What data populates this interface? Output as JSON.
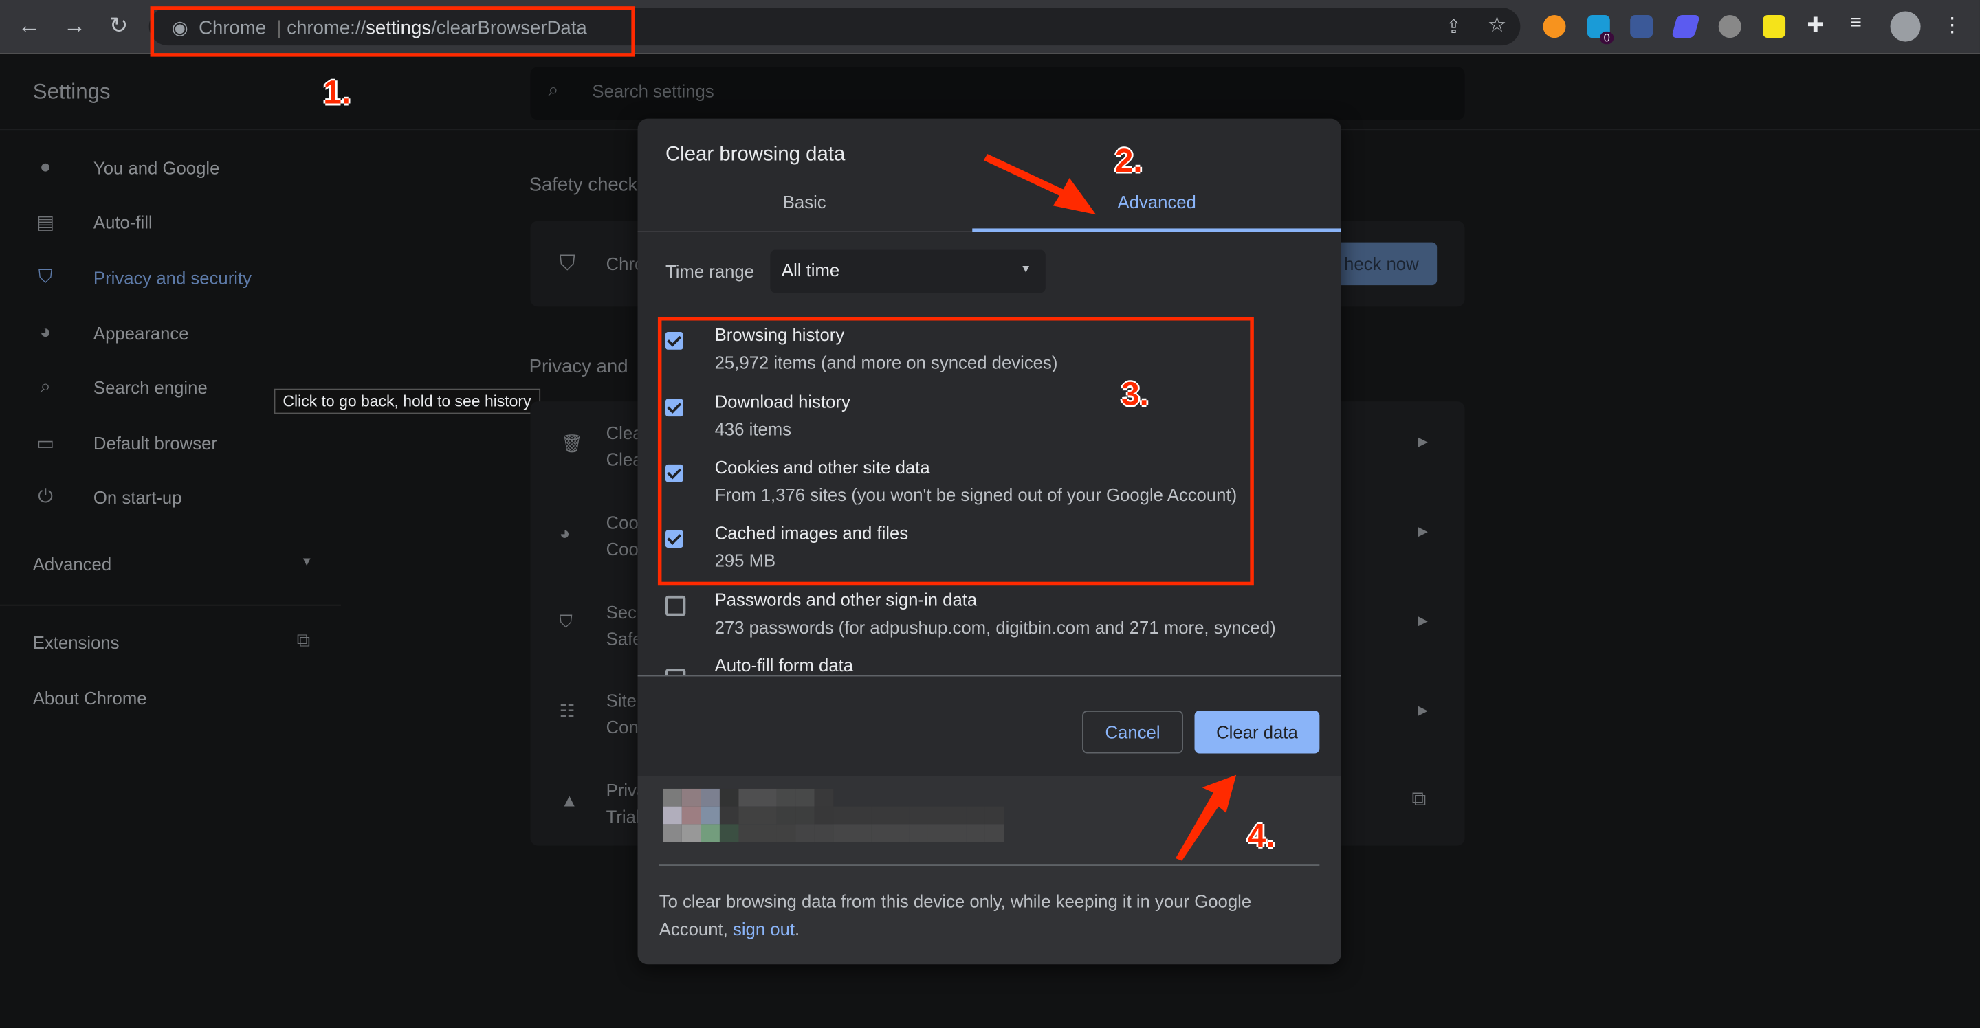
{
  "browser": {
    "omnibox_label": "Chrome",
    "url_prefix": "chrome://",
    "url_host": "settings",
    "url_path": "/clearBrowserData",
    "back_tooltip": "Click to go back, hold to see history",
    "extension_badge": "0"
  },
  "settings": {
    "title": "Settings",
    "search_placeholder": "Search settings",
    "sidebar": [
      {
        "label": "You and Google",
        "icon": "person-icon"
      },
      {
        "label": "Auto-fill",
        "icon": "clipboard-icon"
      },
      {
        "label": "Privacy and security",
        "icon": "shield-icon",
        "active": true
      },
      {
        "label": "Appearance",
        "icon": "palette-icon"
      },
      {
        "label": "Search engine",
        "icon": "search-icon"
      },
      {
        "label": "Default browser",
        "icon": "browser-icon"
      },
      {
        "label": "On start-up",
        "icon": "power-icon"
      }
    ],
    "advanced": "Advanced",
    "extensions": "Extensions",
    "about": "About Chrome",
    "safety_check": "Safety check",
    "safety_card_text": "Chro",
    "check_now": "heck now",
    "privacy_heading": "Privacy and",
    "privacy_rows": [
      {
        "title": "Clea",
        "sub": "Clea"
      },
      {
        "title": "Coo",
        "sub": "Coo"
      },
      {
        "title": "Secu",
        "sub": "Safe"
      },
      {
        "title": "Site",
        "sub": "Con"
      },
      {
        "title": "Priva",
        "sub": "Trial"
      }
    ]
  },
  "dialog": {
    "title": "Clear browsing data",
    "tabs": [
      "Basic",
      "Advanced"
    ],
    "active_tab": "Advanced",
    "time_range_label": "Time range",
    "time_range_value": "All time",
    "items": [
      {
        "label": "Browsing history",
        "sub": "25,972 items (and more on synced devices)",
        "checked": true
      },
      {
        "label": "Download history",
        "sub": "436 items",
        "checked": true
      },
      {
        "label": "Cookies and other site data",
        "sub": "From 1,376 sites (you won't be signed out of your Google Account)",
        "checked": true
      },
      {
        "label": "Cached images and files",
        "sub": "295 MB",
        "checked": true
      },
      {
        "label": "Passwords and other sign-in data",
        "sub": "273 passwords (for adpushup.com, digitbin.com and 271 more, synced)",
        "checked": false
      },
      {
        "label": "Auto-fill form data",
        "sub": "",
        "checked": false
      }
    ],
    "cancel": "Cancel",
    "clear": "Clear data",
    "footer_text": "To clear browsing data from this device only, while keeping it in your Google Account,",
    "sign_out": "sign out",
    "footer_end": "."
  },
  "annotations": [
    "1.",
    "2.",
    "3.",
    "4."
  ],
  "colors": {
    "accent": "#8ab4f8",
    "annotation": "#ff2a00",
    "dialog_bg": "#292a2d"
  }
}
